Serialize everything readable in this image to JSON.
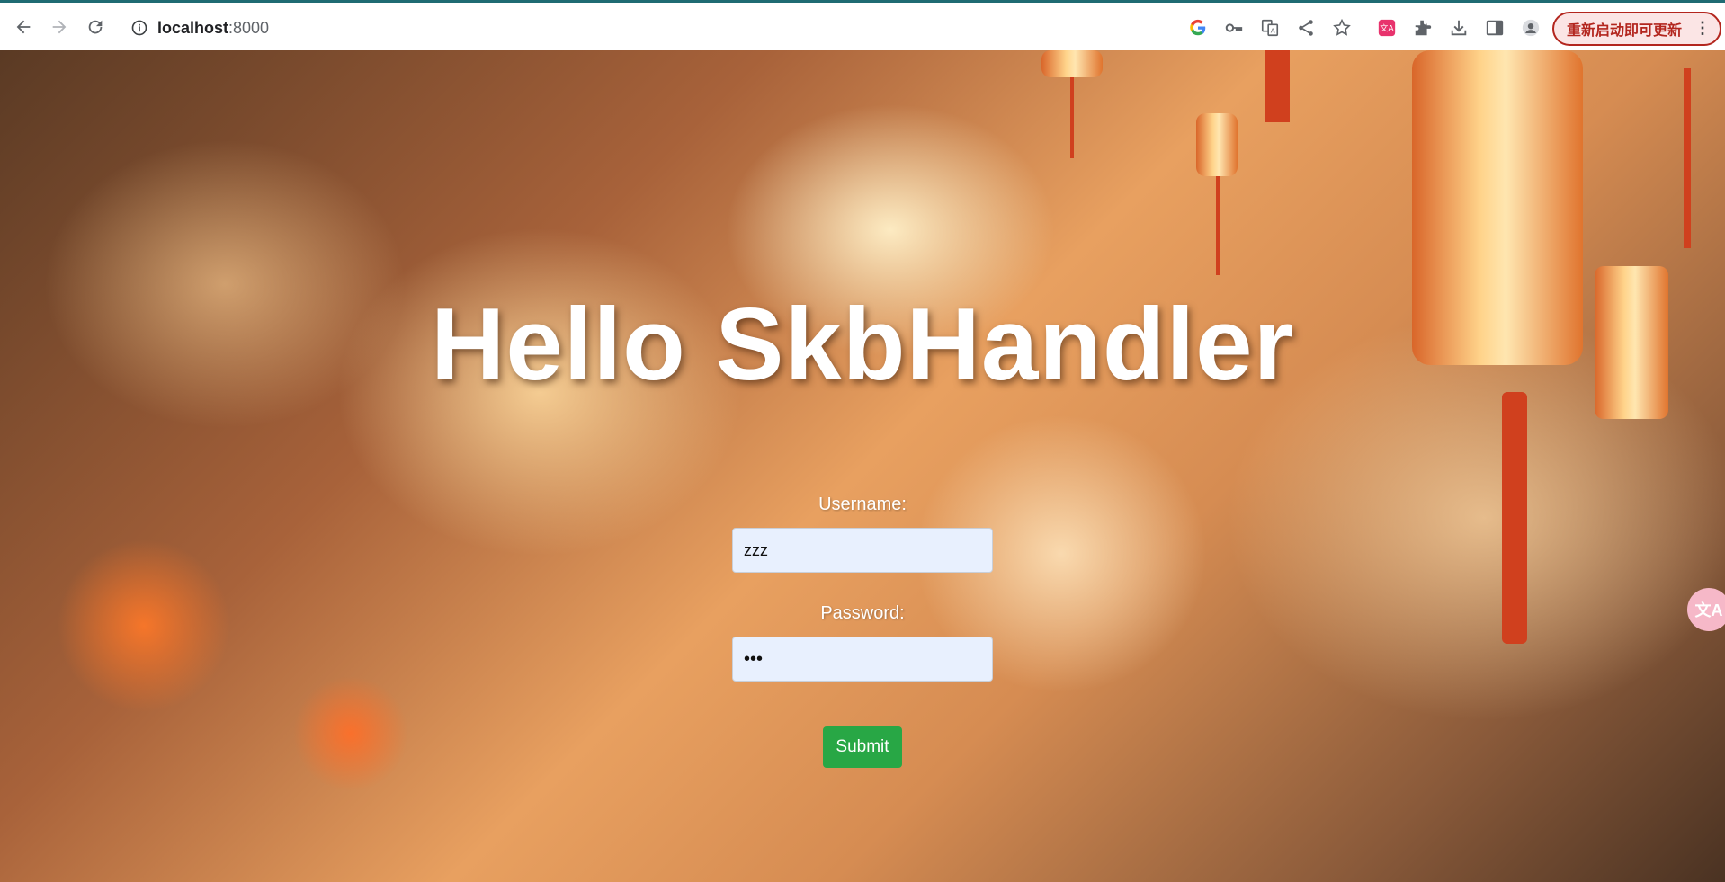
{
  "browser": {
    "url_host": "localhost",
    "url_port": ":8000",
    "update_label": "重新启动即可更新",
    "icons": [
      "back-icon",
      "forward-icon",
      "reload-icon",
      "info-icon",
      "google-icon",
      "key-icon",
      "translate-icon",
      "share-icon",
      "star-icon",
      "extension-translate-icon",
      "puzzle-icon",
      "download-icon",
      "side-panel-icon",
      "profile-icon",
      "more-icon"
    ]
  },
  "page": {
    "title": "Hello SkbHandler",
    "username_label": "Username:",
    "username_value": "zzz",
    "password_label": "Password:",
    "password_value": "•••",
    "submit_label": "Submit",
    "side_badge": "文A"
  },
  "colors": {
    "submit": "#28a745",
    "input_bg": "#e8f0fe",
    "update_border": "#b3261e",
    "chrome_accent": "#1f6b73"
  }
}
